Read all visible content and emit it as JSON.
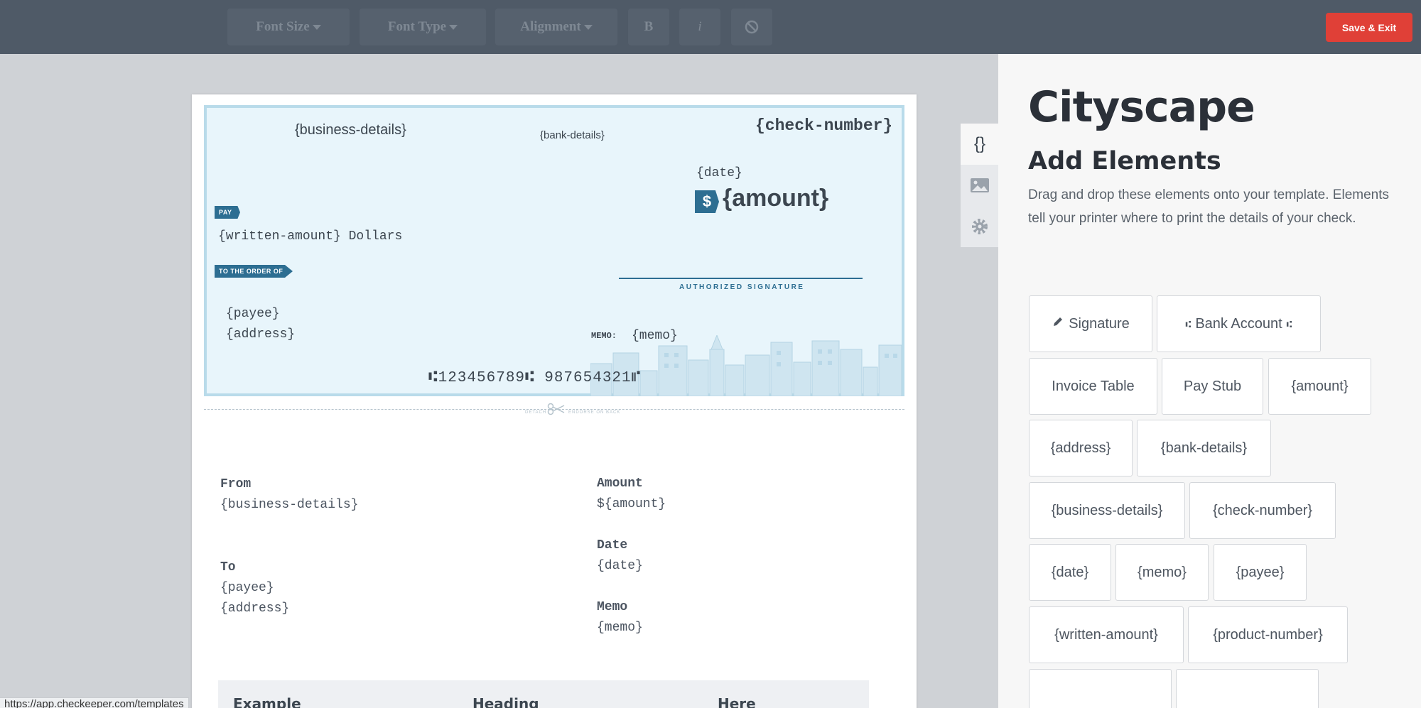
{
  "toolbar": {
    "font_size": "Font Size",
    "font_type": "Font Type",
    "alignment": "Alignment",
    "bold": "B",
    "italic": "i",
    "save_exit": "Save & Exit"
  },
  "check": {
    "business_details": "{business-details}",
    "bank_details": "{bank-details}",
    "check_number": "{check-number}",
    "date": "{date}",
    "amount": "{amount}",
    "dollar_sign": "$",
    "pay_tag": "PAY",
    "written_amount": "{written-amount} Dollars",
    "order_tag": "TO THE ORDER OF",
    "signature_label": "AUTHORIZED SIGNATURE",
    "payee": "{payee}",
    "address": "{address}",
    "memo_label": "MEMO:",
    "memo": "{memo}",
    "micr": "⑆123456789⑆ 987654321⑈",
    "detach_left": "DETACH",
    "detach_right": "ENDORSE ON BACK"
  },
  "stub": {
    "from_label": "From",
    "from_value": "{business-details}",
    "to_label": "To",
    "to_payee": "{payee}",
    "to_address": "{address}",
    "amount_label": "Amount",
    "amount_value": "${amount}",
    "date_label": "Date",
    "date_value": "{date}",
    "memo_label": "Memo",
    "memo_value": "{memo}",
    "table_headers": [
      "Example",
      "Heading",
      "Here"
    ]
  },
  "side_tabs": {
    "variables_icon": "{}"
  },
  "panel": {
    "title": "Cityscape",
    "subtitle": "Add Elements",
    "description": "Drag and drop these elements onto your template. Elements tell your printer where to print the details of your check.",
    "elements": [
      "Signature",
      "Bank Account",
      "Invoice Table",
      "Pay Stub",
      "{amount}",
      "{address}",
      "{bank-details}",
      "{business-details}",
      "{check-number}",
      "{date}",
      "{memo}",
      "{payee}",
      "{written-amount}",
      "{product-number}"
    ]
  },
  "status_bar": {
    "url": "https://app.checkeeper.com/templates"
  },
  "colors": {
    "toolbar_bg": "#4f5a67",
    "save_button": "#e04037",
    "check_bg": "#e8f5fb",
    "accent_blue": "#2d6e92"
  }
}
